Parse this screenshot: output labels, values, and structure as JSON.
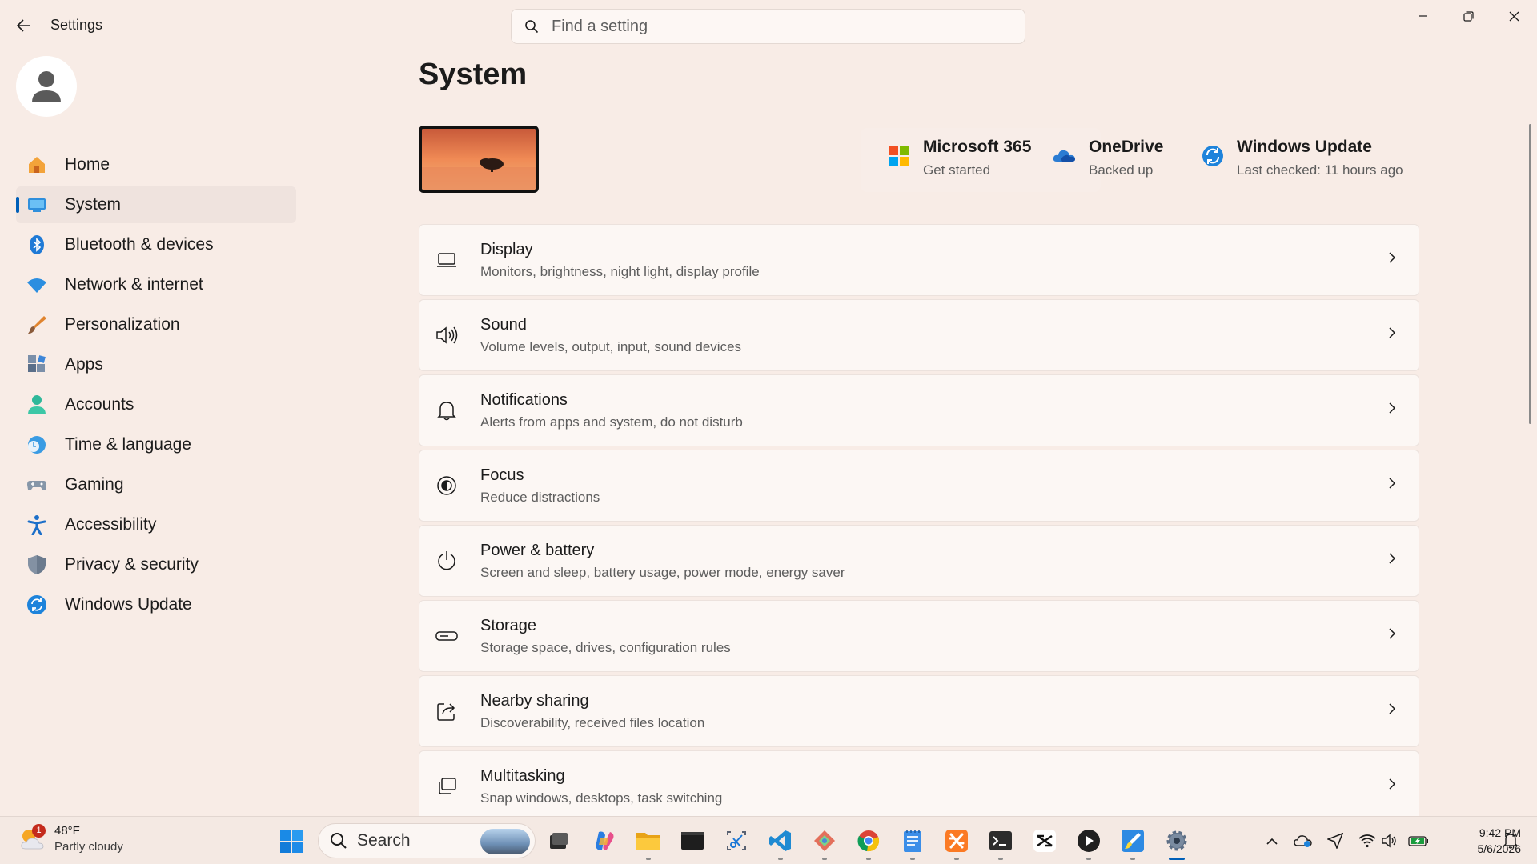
{
  "window": {
    "app_title": "Settings",
    "search_placeholder": "Find a setting"
  },
  "sidebar": {
    "items": [
      {
        "label": "Home",
        "icon": "home-icon"
      },
      {
        "label": "System",
        "icon": "system-icon",
        "active": true
      },
      {
        "label": "Bluetooth & devices",
        "icon": "bluetooth-icon"
      },
      {
        "label": "Network & internet",
        "icon": "wifi-icon"
      },
      {
        "label": "Personalization",
        "icon": "brush-icon"
      },
      {
        "label": "Apps",
        "icon": "apps-icon"
      },
      {
        "label": "Accounts",
        "icon": "accounts-icon"
      },
      {
        "label": "Time & language",
        "icon": "time-language-icon"
      },
      {
        "label": "Gaming",
        "icon": "gamepad-icon"
      },
      {
        "label": "Accessibility",
        "icon": "accessibility-icon"
      },
      {
        "label": "Privacy & security",
        "icon": "shield-icon"
      },
      {
        "label": "Windows Update",
        "icon": "windows-update-icon"
      }
    ]
  },
  "main": {
    "title": "System",
    "services": [
      {
        "title": "Microsoft 365",
        "subtitle": "Get started",
        "icon": "microsoft-365-icon"
      },
      {
        "title": "OneDrive",
        "subtitle": "Backed up",
        "icon": "onedrive-icon"
      },
      {
        "title": "Windows Update",
        "subtitle": "Last checked: 11 hours ago",
        "icon": "windows-update-icon"
      }
    ],
    "settings": [
      {
        "title": "Display",
        "subtitle": "Monitors, brightness, night light, display profile",
        "icon": "display-icon"
      },
      {
        "title": "Sound",
        "subtitle": "Volume levels, output, input, sound devices",
        "icon": "speaker-icon"
      },
      {
        "title": "Notifications",
        "subtitle": "Alerts from apps and system, do not disturb",
        "icon": "bell-icon"
      },
      {
        "title": "Focus",
        "subtitle": "Reduce distractions",
        "icon": "focus-icon"
      },
      {
        "title": "Power & battery",
        "subtitle": "Screen and sleep, battery usage, power mode, energy saver",
        "icon": "power-icon"
      },
      {
        "title": "Storage",
        "subtitle": "Storage space, drives, configuration rules",
        "icon": "storage-icon"
      },
      {
        "title": "Nearby sharing",
        "subtitle": "Discoverability, received files location",
        "icon": "share-icon"
      },
      {
        "title": "Multitasking",
        "subtitle": "Snap windows, desktops, task switching",
        "icon": "multitasking-icon"
      }
    ]
  },
  "taskbar": {
    "weather_temp": "48°F",
    "weather_desc": "Partly cloudy",
    "weather_badge": "1",
    "search_label": "Search",
    "time": "9:42 PM",
    "date": "5/6/2026"
  },
  "colors": {
    "accent": "#005fb8",
    "background": "#f8ece6"
  }
}
